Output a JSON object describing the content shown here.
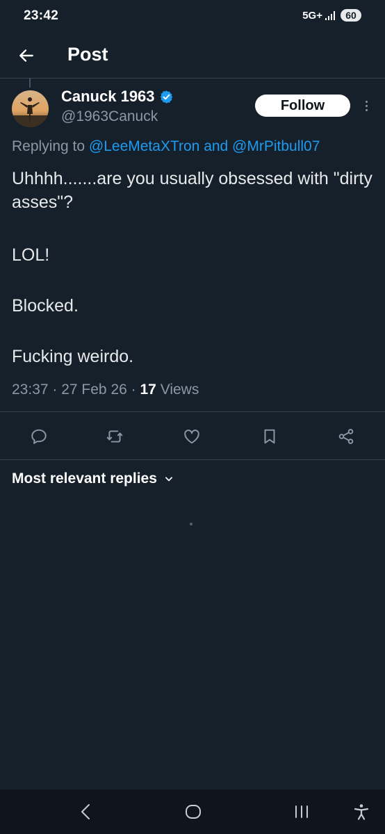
{
  "status_bar": {
    "time": "23:42",
    "network": "5G+",
    "battery": "60"
  },
  "header": {
    "back_icon": "arrow-left-icon",
    "title": "Post"
  },
  "post": {
    "author": {
      "name": "Canuck 1963",
      "handle": "@1963Canuck",
      "verified_icon": "verified-badge-icon",
      "verified_color": "#1d9bf0"
    },
    "follow_label": "Follow",
    "more_icon": "more-vertical-icon",
    "replying_prefix": "Replying to",
    "replying_to": "@LeeMetaXTron and @MrPitbull07",
    "lines": [
      "Uhhhh.......are you usually obsessed with \"dirty asses\"?",
      "LOL!",
      "Blocked.",
      "Fucking weirdo."
    ],
    "time": "23:37",
    "date": "27 Feb 26",
    "views_count": "17",
    "views_label": "Views",
    "separator": " · "
  },
  "actions": [
    {
      "icon": "reply-icon"
    },
    {
      "icon": "repost-icon"
    },
    {
      "icon": "like-icon"
    },
    {
      "icon": "bookmark-icon"
    },
    {
      "icon": "share-icon"
    }
  ],
  "replies": {
    "sort_label": "Most relevant replies",
    "sort_icon": "chevron-down-icon"
  },
  "system_nav": {
    "back_icon": "system-back-icon",
    "home_icon": "system-home-icon",
    "recents_icon": "system-recents-icon",
    "accessibility_icon": "accessibility-icon"
  },
  "colors": {
    "background": "#15202b",
    "text": "#e7e9ea",
    "secondary_text": "#8b98a5",
    "accent": "#1d9bf0",
    "divider": "#38444d"
  }
}
